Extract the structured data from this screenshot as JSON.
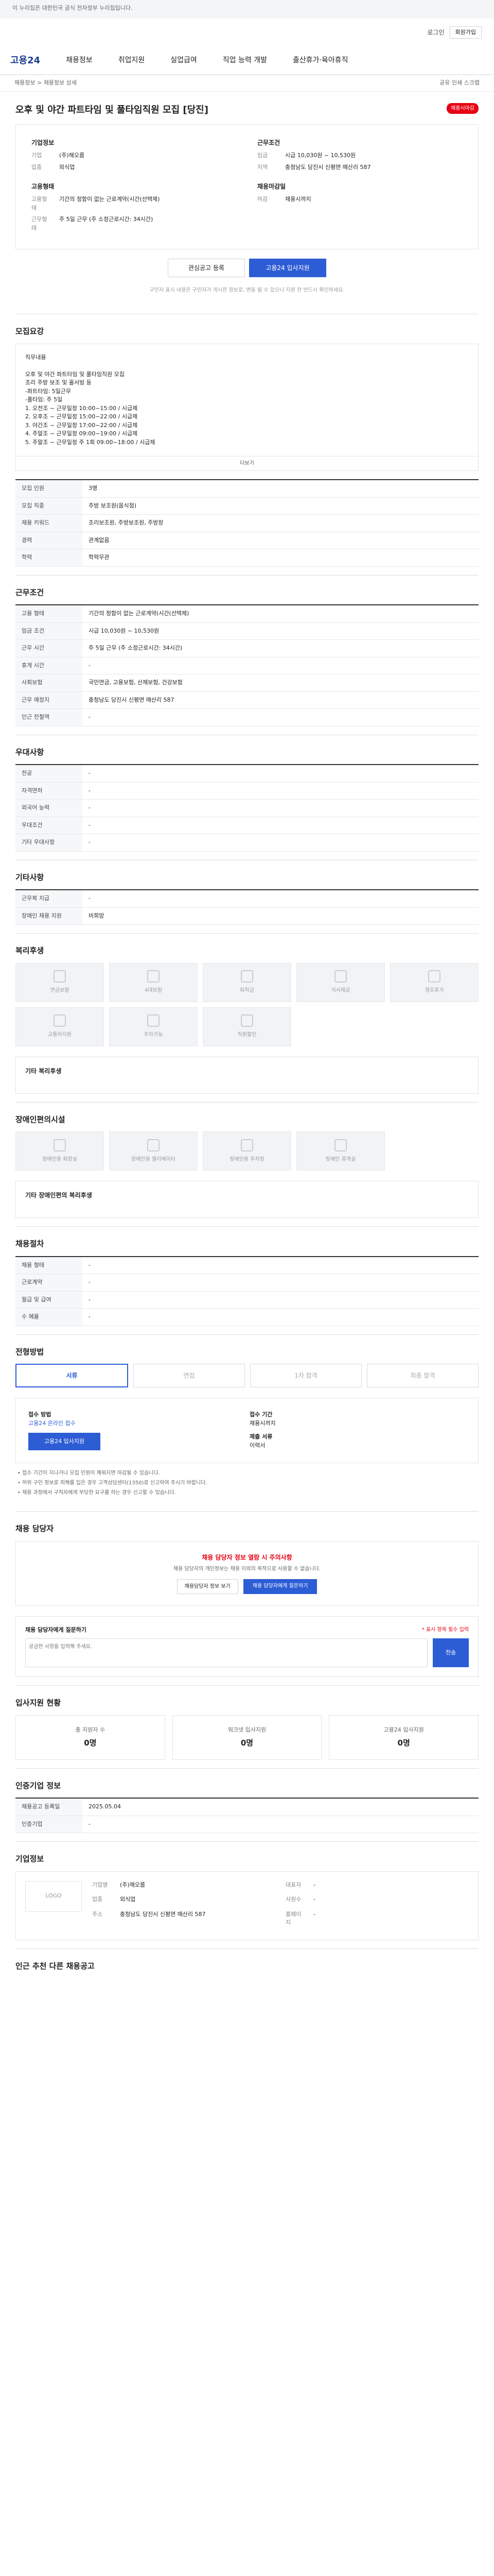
{
  "top_notice": "이 누리집은 대한민국 공식 전자정부 누리집입니다.",
  "govbar": {
    "login": "로그인",
    "join": "회원가입"
  },
  "gnb": {
    "logo": "고용24",
    "menus": [
      "채용정보",
      "취업지원",
      "실업급여",
      "직업 능력 개발",
      "출산휴가·육아휴직"
    ]
  },
  "crumb": {
    "left": "채용정보 > 채용정보 상세",
    "right": "공유 인쇄 스크랩"
  },
  "job": {
    "title": "오후 및 야간 파트타임 및 풀타임직원 모집 [당진]",
    "badge": "채용시마감",
    "company_label": "기업정보",
    "company_rows": [
      {
        "k": "기업",
        "v": "(주)해오름"
      },
      {
        "k": "업종",
        "v": "외식업"
      }
    ],
    "cond_label": "근무조건",
    "cond_rows": [
      {
        "k": "임금",
        "v": "시급 10,030원 ~ 10,530원"
      },
      {
        "k": "지역",
        "v": "충청남도 당진시 신평면 매산리 587"
      }
    ],
    "req_label": "고용형태",
    "req_rows": [
      {
        "k": "고용형태",
        "v": "기간의 정함이 없는 근로계약(시간(선택제)"
      },
      {
        "k": "근무형태",
        "v": "주 5일 근무 (주 소정근로시간: 34시간)"
      }
    ],
    "apply_label": "채용마감일",
    "apply_rows": [
      {
        "k": "마감",
        "v": "채용시까지"
      }
    ]
  },
  "cta": {
    "save": "관심공고 등록",
    "apply": "고용24 입사지원"
  },
  "note": "구인자 표시 내용은 구인자가 게시한 정보로, 변동 될 수 있으니 지원 전 반드시 확인하세요.",
  "sections": {
    "detail": "모집요강",
    "conditions": "근무조건",
    "prefer": "우대사항",
    "extra": "기타사항",
    "welfare": "복리후생",
    "disabled": "장애인편의시설",
    "company": "채용절차",
    "apply": "전형방법",
    "contact": "채용 담당자",
    "status": "입사지원 현황",
    "info": "인증기업 정보",
    "company_info": "기업정보",
    "others": "인근 추천 다른 채용공고"
  },
  "detail_box": "직무내용\n\n오후 및 야간 파트타임 및 풀타임직원 모집\n조리 주방 보조 및 홀서빙 등\n-파트타임: 5일근무\n-풀타임: 주 5일\n1. 오전조 ~ 근무일정 10:00~15:00 / 시급제\n2. 오후조 ~ 근무일정 15:00~22:00 / 시급제\n3. 야간조 ~ 근무일정 17:00~22:00 / 시급제\n4. 주말조 ~ 근무일정 09:00~19:00 / 시급제\n5. 주말조 ~ 근무일정 주 1회 09:00~18:00 / 시급제",
  "expand_label": "더보기",
  "detail_rows": [
    {
      "k": "모집 인원",
      "v": "3명"
    },
    {
      "k": "모집 직종",
      "v": "주방 보조원(음식점)"
    },
    {
      "k": "채용 키워드",
      "v": "조리보조원, 주방보조원, 주방장"
    },
    {
      "k": "경력",
      "v": "관계없음"
    },
    {
      "k": "학력",
      "v": "학력무관"
    }
  ],
  "cond_rows": [
    {
      "k": "고용 형태",
      "v": "기간의 정함이 없는 근로계약(시간(선택제)"
    },
    {
      "k": "임금 조건",
      "v": "시급 10,030원 ~ 10,530원"
    },
    {
      "k": "근무 시간",
      "v": "주 5일 근무 (주 소정근로시간: 34시간)"
    },
    {
      "k": "휴게 시간",
      "v": "-"
    },
    {
      "k": "사회보험",
      "v": "국민연금, 고용보험, 산재보험, 건강보험"
    },
    {
      "k": "근무 예정지",
      "v": "충청남도 당진시 신평면 매산리 587"
    },
    {
      "k": "인근 전철역",
      "v": "-"
    }
  ],
  "prefer_rows": [
    {
      "k": "전공",
      "v": "-"
    },
    {
      "k": "자격면허",
      "v": "-"
    },
    {
      "k": "외국어 능력",
      "v": "-"
    },
    {
      "k": "우대조건",
      "v": "-"
    },
    {
      "k": "기타 우대사항",
      "v": "-"
    }
  ],
  "extra_rows": [
    {
      "k": "근무복 지급",
      "v": "-"
    },
    {
      "k": "장애인 채용 지원",
      "v": "비희망"
    }
  ],
  "welfare_items": [
    "연금보험",
    "4대보험",
    "퇴직금",
    "식사제공",
    "경조휴가",
    "교통비지원",
    "주차가능",
    "직원할인"
  ],
  "welfare_sub": "기타 복리후생",
  "disabled_items": [
    "장애인용 화장실",
    "장애인용 엘리베이터",
    "장애인용 주차장",
    "장애인 휴게실"
  ],
  "disabled_sub": "기타 장애인편의 복리후생",
  "company_rows": [
    {
      "k": "채용 형태",
      "v": "-"
    },
    {
      "k": "근로계약",
      "v": "-"
    },
    {
      "k": "월급 및 급여",
      "v": "-"
    },
    {
      "k": "수 혜율",
      "v": "-"
    }
  ],
  "steps": [
    "서류",
    "면접",
    "1차 합격",
    "최종 합격"
  ],
  "apply_box": {
    "method_label": "접수 방법",
    "method_value": "고용24 온라인 접수",
    "period_label": "접수 기간",
    "period_value": "채용시까지",
    "doc_label": "제출 서류",
    "doc_value": "이력서",
    "button": "고용24 입사지원"
  },
  "bullets": [
    "• 접수 기간이 지나거나 모집 인원이 채워지면 마감될 수 있습니다.",
    "• 허위 구인 정보로 피해를 입은 경우 고객상담센터(1350)로 신고하여 주시기 바랍니다.",
    "• 채용 과정에서 구직자에게 부당한 요구를 하는 경우 신고할 수 있습니다."
  ],
  "warn": {
    "title": "채용 담당자 정보 열람 시 주의사항",
    "desc": "채용 담당자의 개인정보는 채용 이외의 목적으로 사용할 수 없습니다.",
    "btn1": "채용담당자 정보 보기",
    "btn2": "채용 담당자에게 질문하기"
  },
  "qna": {
    "title": "채용 담당자에게 질문하기",
    "required": "* 표시 항목 필수 입력",
    "placeholder": "궁금한 사항을 입력해 주세요.",
    "send": "전송"
  },
  "stats": [
    {
      "label": "총 지원자 수",
      "value": "0명"
    },
    {
      "label": "워크넷 입사지원",
      "value": "0명"
    },
    {
      "label": "고용24 입사지원",
      "value": "0명"
    }
  ],
  "info_rows": [
    {
      "k": "채용공고 등록일",
      "v": "2025.05.04"
    },
    {
      "k": "인증기업",
      "v": "-"
    }
  ],
  "listing": {
    "logo": "LOGO",
    "rows": [
      {
        "k": "기업명",
        "v": "(주)해오름"
      },
      {
        "k": "대표자",
        "v": "-"
      },
      {
        "k": "업종",
        "v": "외식업"
      },
      {
        "k": "사원수",
        "v": "-"
      },
      {
        "k": "주소",
        "v": "충청남도 당진시 신평면 매산리 587"
      },
      {
        "k": "홈페이지",
        "v": "-"
      }
    ]
  }
}
